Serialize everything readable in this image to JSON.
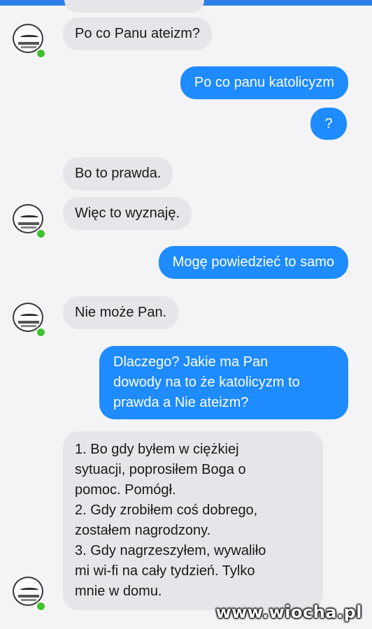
{
  "colors": {
    "outgoing_bubble": "#1e8bff",
    "incoming_bubble": "#e6e6ea",
    "background": "#f4f4f6",
    "online_dot": "#3ec22d",
    "header_accent": "#2c7ee8"
  },
  "contact": {
    "avatar_icon": "profile-photo",
    "status": "online"
  },
  "messages": [
    {
      "side": "incoming",
      "text": "Po co Panu ateizm?"
    },
    {
      "side": "outgoing",
      "text": "Po co panu katolicyzm"
    },
    {
      "side": "outgoing",
      "text": "?"
    },
    {
      "side": "incoming",
      "text": "Bo to prawda."
    },
    {
      "side": "incoming",
      "text": "Więc to wyznaję."
    },
    {
      "side": "outgoing",
      "text": "Mogę powiedzieć to samo"
    },
    {
      "side": "incoming",
      "text": "Nie może Pan."
    },
    {
      "side": "outgoing",
      "text": "Dlaczego? Jakie ma Pan\ndowody na to że katolicyzm to\nprawda a Nie ateizm?"
    },
    {
      "side": "incoming",
      "text": "1. Bo gdy byłem w ciężkiej\nsytuacji, poprosiłem Boga o\npomoc. Pomógł.\n2. Gdy zrobiłem coś dobrego,\nzostałem nagrodzony.\n3. Gdy nagrzeszyłem, wywaliło\nmi wi-fi na cały tydzień. Tylko\nmnie w domu."
    }
  ],
  "watermark": "www.wiocha.pl"
}
